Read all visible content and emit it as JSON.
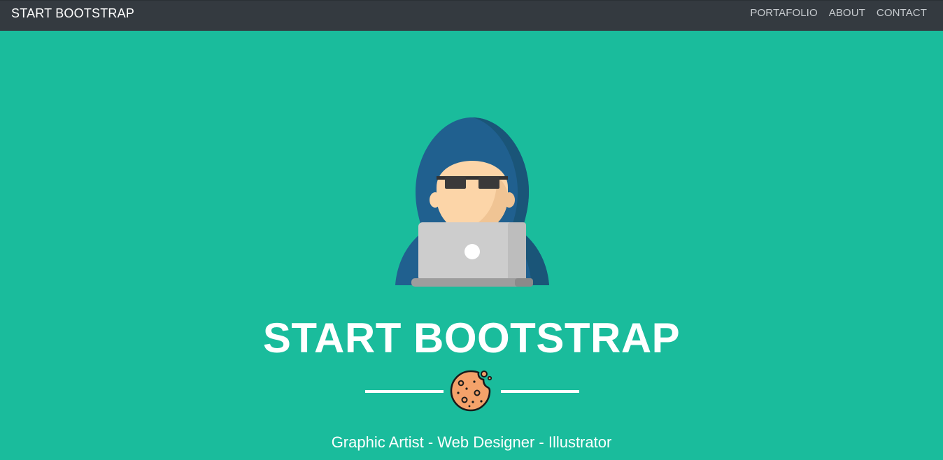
{
  "navbar": {
    "brand": "START BOOTSTRAP",
    "links": [
      {
        "label": "PORTAFOLIO"
      },
      {
        "label": "ABOUT"
      },
      {
        "label": "CONTACT"
      }
    ],
    "background": "#343a40"
  },
  "masthead": {
    "avatar_icon": "hooded-hacker-with-laptop-icon",
    "heading": "START BOOTSTRAP",
    "divider_icon": "cookie-icon",
    "subheading": "Graphic Artist - Web Designer - Illustrator",
    "background": "#1abc9c"
  }
}
